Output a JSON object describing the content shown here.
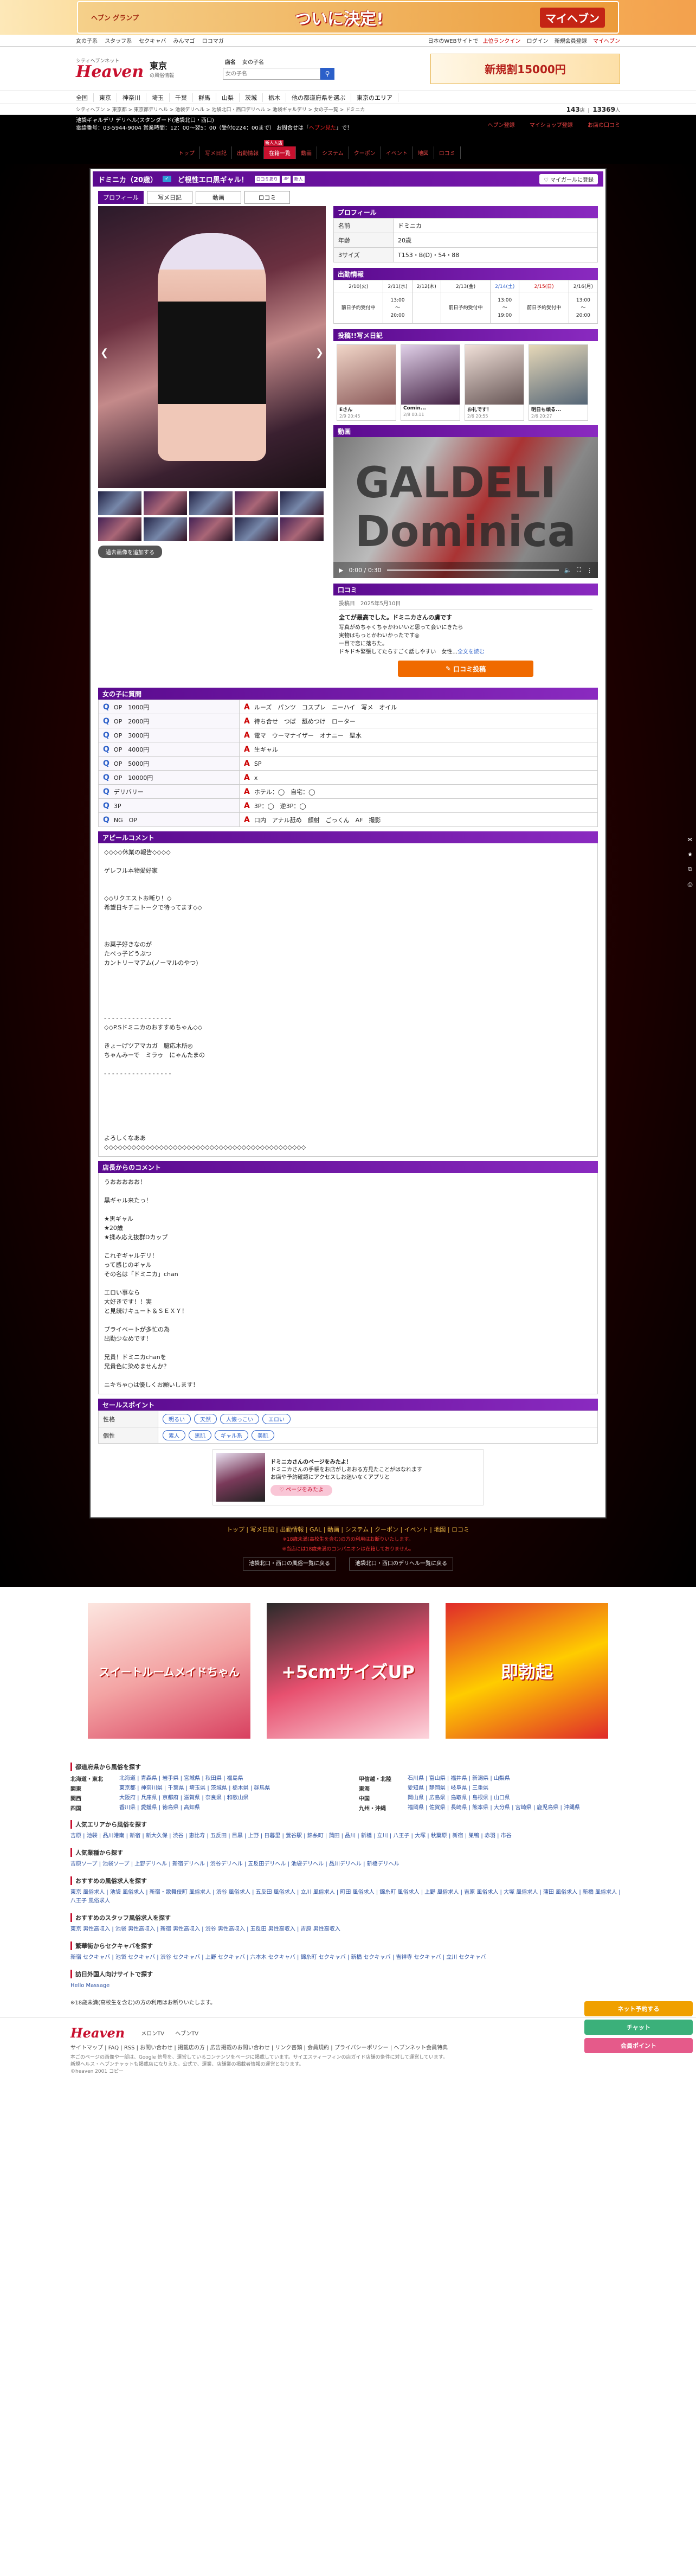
{
  "top_banner": {
    "left": "ヘブン\nグランプ",
    "main": "ついに決定!",
    "right": "マイヘブン"
  },
  "subnav": {
    "left": [
      "女の子系",
      "スタッフ系",
      "セクキャバ",
      "みんマゴ",
      "ロコマガ"
    ],
    "right": [
      "日本のWEBサイトで",
      "上位ランクイン",
      "ログイン",
      "新規会員登録",
      "マイヘブン"
    ]
  },
  "header": {
    "logo": "Heaven",
    "logo_sub": "シティヘブンネット",
    "area": "東京",
    "area_sub": "の風俗情報",
    "search_tabs": [
      "店名",
      "女の子名"
    ],
    "search_placeholder": "女の子名",
    "banner": "新規割15000円"
  },
  "prefnav": [
    "全国",
    "東京",
    "神奈川",
    "埼玉",
    "千葉",
    "群馬",
    "山梨",
    "茨城",
    "栃木",
    "他の都道府県を選ぶ",
    "東京のエリア"
  ],
  "breadcrumb": "シティヘブン > 東京都 > 東京都デリヘル > 池袋デリヘル > 池袋北口・西口デリヘル > 池袋ギャルデリ > 女の子一覧 > ドミニカ",
  "counts": {
    "shops": "143",
    "shops_unit": "店",
    "girls": "13369",
    "girls_unit": "人"
  },
  "shop": {
    "line1": "池袋ギャルデリ デリヘル(スタンダード(池袋北口・西口)",
    "line2a": "電話番号：03-5944-9004 営業時間：12：00〜翌5：00（受付0224：00まで） お問合せは「",
    "line2b": "ヘブン見た",
    "line2c": "」で！",
    "links": [
      "ヘブン登録",
      "マイショップ登録",
      "お店の口コミ"
    ],
    "nav": [
      "トップ",
      "写メ日記",
      "出勤情報",
      "在籍一覧",
      "動画",
      "システム",
      "クーポン",
      "イベント",
      "地図",
      "ロコミ"
    ]
  },
  "profile_bar": {
    "name": "ドミニカ（20歳）",
    "badge": "✓",
    "catch": "ど根性エロ黒ギャル！",
    "tags": [
      "ロコミあり",
      "3P",
      "新人"
    ],
    "mypage": "マイガールに登録"
  },
  "tabs": [
    "プロフィール",
    "写メ日記",
    "動画",
    "ロコミ"
  ],
  "more_photos": "過去画像を追加する",
  "profile": {
    "title": "プロフィール",
    "rows": [
      {
        "k": "名前",
        "v": "ドミニカ"
      },
      {
        "k": "年齢",
        "v": "20歳"
      },
      {
        "k": "3サイズ",
        "v": "T153・B(D)・54・88"
      }
    ]
  },
  "schedule": {
    "title": "出勤情報",
    "days": [
      "2/10(火)",
      "2/11(水)",
      "2/12(木)",
      "2/13(金)",
      "2/14(土)",
      "2/15(日)",
      "2/16(月)"
    ],
    "slots": [
      [
        "前日予約受付中",
        "13:00\n〜\n20:00",
        "",
        "前日予約受付中",
        "13:00\n〜\n19:00",
        "前日予約受付中",
        "13:00\n〜\n20:00"
      ]
    ]
  },
  "diary": {
    "title": "投稿!!写メ日記",
    "items": [
      {
        "t": "Eさん",
        "d": "2/9 20:45"
      },
      {
        "t": "Comin...",
        "d": "2/8 00:11"
      },
      {
        "t": "お礼です！",
        "d": "2/6 20:55"
      },
      {
        "t": "明日も頑る...",
        "d": "2/6 20:27"
      }
    ]
  },
  "video": {
    "title": "動画",
    "watermark1": "GALDELI",
    "watermark2": "Dominica",
    "time": "0:00 / 0:30"
  },
  "review": {
    "title": "口コミ",
    "date": "投稿日　2025年5月10日",
    "heading": "全てが最高でした。ドミニカさんの虜です",
    "body": "写真がめちゃくちゃかわいいと思って会いにきたら\n実物はもっとかわいかったです◎\n一目で恋に落ちた。\nドキドキ緊張してたらすごく話しやすい　女性...",
    "more": "全文を読む",
    "button": "口コミ投稿"
  },
  "qa": {
    "title": "女の子に質問",
    "rows": [
      {
        "q": "OP　1000円",
        "a": "ルーズ　パンツ　コスプレ　ニーハイ　写メ　オイル"
      },
      {
        "q": "OP　2000円",
        "a": "待ち合せ　つば　舐めつけ　ローター"
      },
      {
        "q": "OP　3000円",
        "a": "電マ　ウーマナイザー　オナニー　聖水"
      },
      {
        "q": "OP　4000円",
        "a": "生ギャル"
      },
      {
        "q": "OP　5000円",
        "a": "SP"
      },
      {
        "q": "OP　10000円",
        "a": "x"
      },
      {
        "q": "デリバリー",
        "a": "ホテル：◯　自宅：◯"
      },
      {
        "q": "3P",
        "a": "3P：◯　逆3P：◯"
      },
      {
        "q": "NG　OP",
        "a": "口内　アナル舐め　顔射　ごっくん　AF　撮影"
      }
    ]
  },
  "appeal": {
    "title": "アピールコメント",
    "text": "◇◇◇◇休業の報告◇◇◇◇\n\nゲレフル本物愛好家\n\n\n◇◇リクエストお断り！◇\n希望日キチニトークで待ってます◇◇\n\n\n\nお菓子好きなのが\nたべっ子どうぶつ\nカントリーマアム(ノーマルのやつ)\n\n\n\n\n\n- - - - - - - - - - - - - - - - -\n◇◇P.Sドミニカのおすすめちゃん◇◇\n\nきょーげツアマカガ　臆応木所◎\nちゃんみーで　ミラゥ　にゃんたまの\n\n- - - - - - - - - - - - - - - - -\n\n\n\n\n\n\nよろしくなああ\n◇◇◇◇◇◇◇◇◇◇◇◇◇◇◇◇◇◇◇◇◇◇◇◇◇◇◇◇◇◇◇◇◇◇◇◇◇◇◇◇◇◇◇◇"
  },
  "shop_comment": {
    "title": "店長からのコメント",
    "text": "うおおおおお！\n\n黒ギャル来たっ！\n\n★黒ギャル\n★20歳\n★揉み応え抜群Dカップ\n\nこれぞギャルデリ！\nって感じのギャル\nその名は「ドミニカ」chan\n\nエロい事なら\n大好きです！！実\nと見続けキュート＆ＳＥＸＹ！\n\nプライベートが多忙の為\n出勤少なめです！\n\n兄貴！ドミニカchanを\n兄貴色に染めませんか？\n\nニキちゃ○は優しくお願いします！"
  },
  "sales": {
    "title": "セールスポイント",
    "rows": [
      {
        "k": "性格",
        "v": [
          "明るい",
          "天然",
          "人懐っこい",
          "エロい"
        ]
      },
      {
        "k": "個性",
        "v": [
          "素人",
          "黒肌",
          "ギャル系",
          "美肌"
        ]
      }
    ]
  },
  "page_link": {
    "text1": "ドミニカさんのページをみたよ！",
    "text2": "ドミニカさんの手帳をお店がしあおる方見たことがはなれます\nお店や予約確認にアクセスしお迷いなくアプリと",
    "button": "ページをみたよ"
  },
  "dark_footer": {
    "nav": "トップ | 写メ日記 | 出勤情報 | GAL | 動画 | システム | クーポン | イベント | 地図 | ロコミ",
    "warn1": "※18歳未満(高校生を含む)の方の利用はお断りいたします。",
    "warn2": "※当店には18歳未満のコンパニオンは在籍しておりません。",
    "links": [
      "池袋北口・西口の風俗一覧に戻る",
      "池袋北口・西口のデリヘル一覧に戻る"
    ]
  },
  "side": {
    "next": "次の女の子",
    "prev": "前の女の子",
    "float": [
      "ネット予約する",
      "チャット",
      "会員ポイント"
    ]
  },
  "ads": [
    "スイートルームメイドちゃん",
    "+5cmサイズUP",
    "即勃起"
  ],
  "bottom": {
    "title1": "都道府県から風俗を探す",
    "regions": [
      {
        "k": "北海道・東北",
        "v": "北海道 | 青森県 | 岩手県 | 宮城県 | 秋田県 | 福島県"
      },
      {
        "k": "甲信越・北陸",
        "v": "石川県 | 富山県 | 福井県 | 新潟県 | 山梨県"
      },
      {
        "k": "関東",
        "v": "東京都 | 神奈川県 | 千葉県 | 埼玉県 | 茨城県 | 栃木県 | 群馬県"
      },
      {
        "k": "東海",
        "v": "愛知県 | 静岡県 | 岐阜県 | 三重県"
      },
      {
        "k": "関西",
        "v": "大阪府 | 兵庫県 | 京都府 | 滋賀県 | 奈良県 | 和歌山県"
      },
      {
        "k": "中国",
        "v": "岡山県 | 広島県 | 鳥取県 | 島根県 | 山口県"
      },
      {
        "k": "四国",
        "v": "香川県 | 愛媛県 | 徳島県 | 高知県"
      },
      {
        "k": "九州・沖縄",
        "v": "福岡県 | 佐賀県 | 長崎県 | 熊本県 | 大分県 | 宮崎県 | 鹿児島県 | 沖縄県"
      }
    ],
    "title2": "人気エリアから風俗を探す",
    "line2": "吉原 | 池袋 | 品川港南 | 新宿 | 新大久保 | 渋谷 | 恵比寿 | 五反田 | 目黒 | 上野 | 日暮里 | 鶯谷駅 | 錦糸町 | 蒲田 | 品川 | 新橋 | 立川 | 八王子 | 大塚 | 秋葉原 | 新宿 | 巣鴨 | 赤羽 | 市谷",
    "title3": "人気業種から探す",
    "line3": "吉原ソープ | 池袋ソープ | 上野デリヘル | 新宿デリヘル | 渋谷デリヘル | 五反田デリヘル | 池袋デリヘル | 品川デリヘル | 新橋デリヘル",
    "title4": "おすすめの風俗求人を探す",
    "line4": "東京 風俗求人 | 池袋 風俗求人 | 新宿・歌舞伎町 風俗求人 | 渋谷 風俗求人 | 五反田 風俗求人 | 立川 風俗求人 | 町田 風俗求人 | 錦糸町 風俗求人 | 上野 風俗求人 | 吉原 風俗求人 | 大塚 風俗求人 | 蒲田 風俗求人 | 新橋 風俗求人 | 八王子 風俗求人",
    "title5": "おすすめのスタッフ風俗求人を探す",
    "line5": "東京 男性高収入 | 池袋 男性高収入 | 新宿 男性高収入 | 渋谷 男性高収入 | 五反田 男性高収入 | 吉原 男性高収入",
    "title6": "繁華街からセクキャバを探す",
    "line6": "新宿 セクキャバ | 池袋 セクキャバ | 渋谷 セクキャバ | 上野 セクキャバ | 六本木 セクキャバ | 錦糸町 セクキャバ | 新橋 セクキャバ | 吉祥寺 セクキャバ | 立川 セクキャバ",
    "title7": "訪日外国人向けサイトで探す",
    "line7": "Hello Massage",
    "note": "※18歳未満(高校生を含む)の方の利用はお断りいたします。"
  },
  "footer": {
    "logo": "Heaven",
    "links1": "メロンTV　　ヘブンTV",
    "links2": "サイトマップ | FAQ | RSS | お問い合わせ | 掲載店の方 | 広告掲載のお問い合わせ | リンク書類 | 会員規約 | プライバシーポリシー | ヘブンネット会員特典",
    "copy": "本ごのページの画像や一部は、Google 信号を、運営しているコンテンツをページに掲載しています。サイエスティーフィンの店ガイド店舗の条件に対して運営しています。\n新規ヘルス・ヘブンチャットも掲載店になりえた。公式で、運業、店舗業の掲載者情報の運営となります。\n©heaven 2001 コピー"
  }
}
